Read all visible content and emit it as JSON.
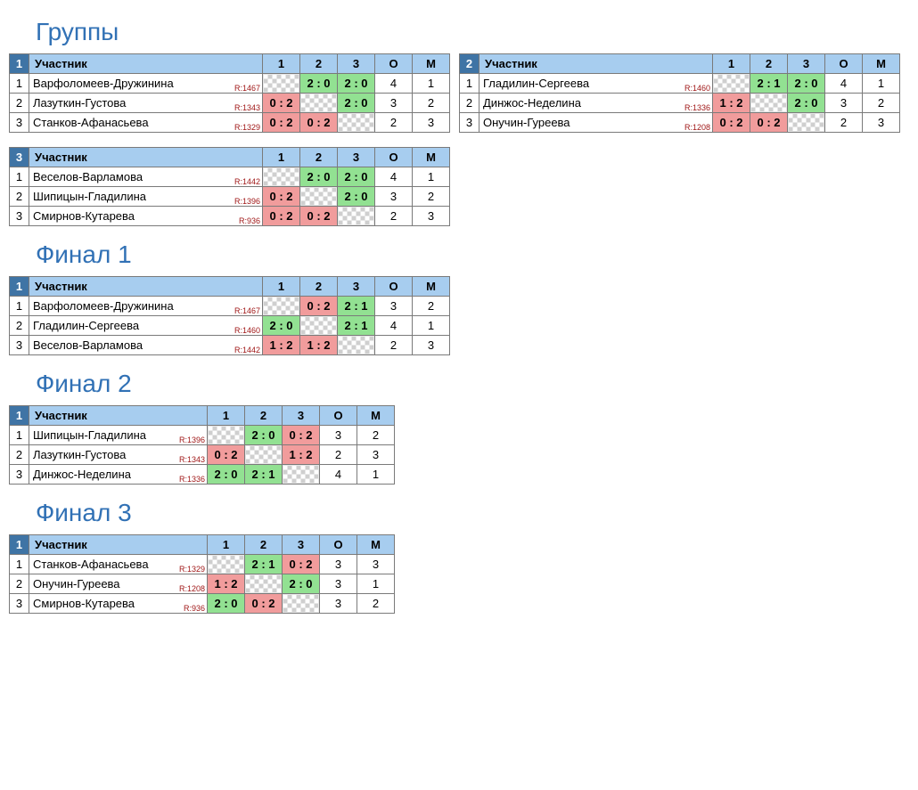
{
  "labels": {
    "participant": "Участник",
    "points": "О",
    "place": "М"
  },
  "sections": [
    {
      "title": "Группы",
      "tables": [
        {
          "num": "1",
          "name_w": 262,
          "rows": [
            {
              "n": "1",
              "name": "Варфоломеев-Дружинина",
              "r": "R:1467",
              "cells": [
                "self",
                "2 : 0",
                "2 : 0"
              ],
              "res": [
                "",
                "w",
                "w"
              ],
              "o": "4",
              "m": "1"
            },
            {
              "n": "2",
              "name": "Лазуткин-Густова",
              "r": "R:1343",
              "cells": [
                "0 : 2",
                "self",
                "2 : 0"
              ],
              "res": [
                "l",
                "",
                "w"
              ],
              "o": "3",
              "m": "2"
            },
            {
              "n": "3",
              "name": "Станков-Афанасьева",
              "r": "R:1329",
              "cells": [
                "0 : 2",
                "0 : 2",
                "self"
              ],
              "res": [
                "l",
                "l",
                ""
              ],
              "o": "2",
              "m": "3"
            }
          ]
        },
        {
          "num": "2",
          "name_w": 262,
          "rows": [
            {
              "n": "1",
              "name": "Гладилин-Сергеева",
              "r": "R:1460",
              "cells": [
                "self",
                "2 : 1",
                "2 : 0"
              ],
              "res": [
                "",
                "w",
                "w"
              ],
              "o": "4",
              "m": "1"
            },
            {
              "n": "2",
              "name": "Динжос-Неделина",
              "r": "R:1336",
              "cells": [
                "1 : 2",
                "self",
                "2 : 0"
              ],
              "res": [
                "l",
                "",
                "w"
              ],
              "o": "3",
              "m": "2"
            },
            {
              "n": "3",
              "name": "Онучин-Гуреева",
              "r": "R:1208",
              "cells": [
                "0 : 2",
                "0 : 2",
                "self"
              ],
              "res": [
                "l",
                "l",
                ""
              ],
              "o": "2",
              "m": "3"
            }
          ]
        },
        {
          "num": "3",
          "name_w": 262,
          "rows": [
            {
              "n": "1",
              "name": "Веселов-Варламова",
              "r": "R:1442",
              "cells": [
                "self",
                "2 : 0",
                "2 : 0"
              ],
              "res": [
                "",
                "w",
                "w"
              ],
              "o": "4",
              "m": "1"
            },
            {
              "n": "2",
              "name": "Шипицын-Гладилина",
              "r": "R:1396",
              "cells": [
                "0 : 2",
                "self",
                "2 : 0"
              ],
              "res": [
                "l",
                "",
                "w"
              ],
              "o": "3",
              "m": "2"
            },
            {
              "n": "3",
              "name": "Смирнов-Кутарева",
              "r": "R:936",
              "cells": [
                "0 : 2",
                "0 : 2",
                "self"
              ],
              "res": [
                "l",
                "l",
                ""
              ],
              "o": "2",
              "m": "3"
            }
          ]
        }
      ]
    },
    {
      "title": "Финал 1",
      "tables": [
        {
          "num": "1",
          "name_w": 262,
          "rows": [
            {
              "n": "1",
              "name": "Варфоломеев-Дружинина",
              "r": "R:1467",
              "cells": [
                "self",
                "0 : 2",
                "2 : 1"
              ],
              "res": [
                "",
                "l",
                "w"
              ],
              "o": "3",
              "m": "2"
            },
            {
              "n": "2",
              "name": "Гладилин-Сергеева",
              "r": "R:1460",
              "cells": [
                "2 : 0",
                "self",
                "2 : 1"
              ],
              "res": [
                "w",
                "",
                "w"
              ],
              "o": "4",
              "m": "1"
            },
            {
              "n": "3",
              "name": "Веселов-Варламова",
              "r": "R:1442",
              "cells": [
                "1 : 2",
                "1 : 2",
                "self"
              ],
              "res": [
                "l",
                "l",
                ""
              ],
              "o": "2",
              "m": "3"
            }
          ]
        }
      ]
    },
    {
      "title": "Финал 2",
      "tables": [
        {
          "num": "1",
          "name_w": 200,
          "rows": [
            {
              "n": "1",
              "name": "Шипицын-Гладилина",
              "r": "R:1396",
              "cells": [
                "self",
                "2 : 0",
                "0 : 2"
              ],
              "res": [
                "",
                "w",
                "l"
              ],
              "o": "3",
              "m": "2"
            },
            {
              "n": "2",
              "name": "Лазуткин-Густова",
              "r": "R:1343",
              "cells": [
                "0 : 2",
                "self",
                "1 : 2"
              ],
              "res": [
                "l",
                "",
                "l"
              ],
              "o": "2",
              "m": "3"
            },
            {
              "n": "3",
              "name": "Динжос-Неделина",
              "r": "R:1336",
              "cells": [
                "2 : 0",
                "2 : 1",
                "self"
              ],
              "res": [
                "w",
                "w",
                ""
              ],
              "o": "4",
              "m": "1"
            }
          ]
        }
      ]
    },
    {
      "title": "Финал 3",
      "tables": [
        {
          "num": "1",
          "name_w": 200,
          "rows": [
            {
              "n": "1",
              "name": "Станков-Афанасьева",
              "r": "R:1329",
              "cells": [
                "self",
                "2 : 1",
                "0 : 2"
              ],
              "res": [
                "",
                "w",
                "l"
              ],
              "o": "3",
              "m": "3"
            },
            {
              "n": "2",
              "name": "Онучин-Гуреева",
              "r": "R:1208",
              "cells": [
                "1 : 2",
                "self",
                "2 : 0"
              ],
              "res": [
                "l",
                "",
                "w"
              ],
              "o": "3",
              "m": "1"
            },
            {
              "n": "3",
              "name": "Смирнов-Кутарева",
              "r": "R:936",
              "cells": [
                "2 : 0",
                "0 : 2",
                "self"
              ],
              "res": [
                "w",
                "l",
                ""
              ],
              "o": "3",
              "m": "2"
            }
          ]
        }
      ]
    }
  ]
}
